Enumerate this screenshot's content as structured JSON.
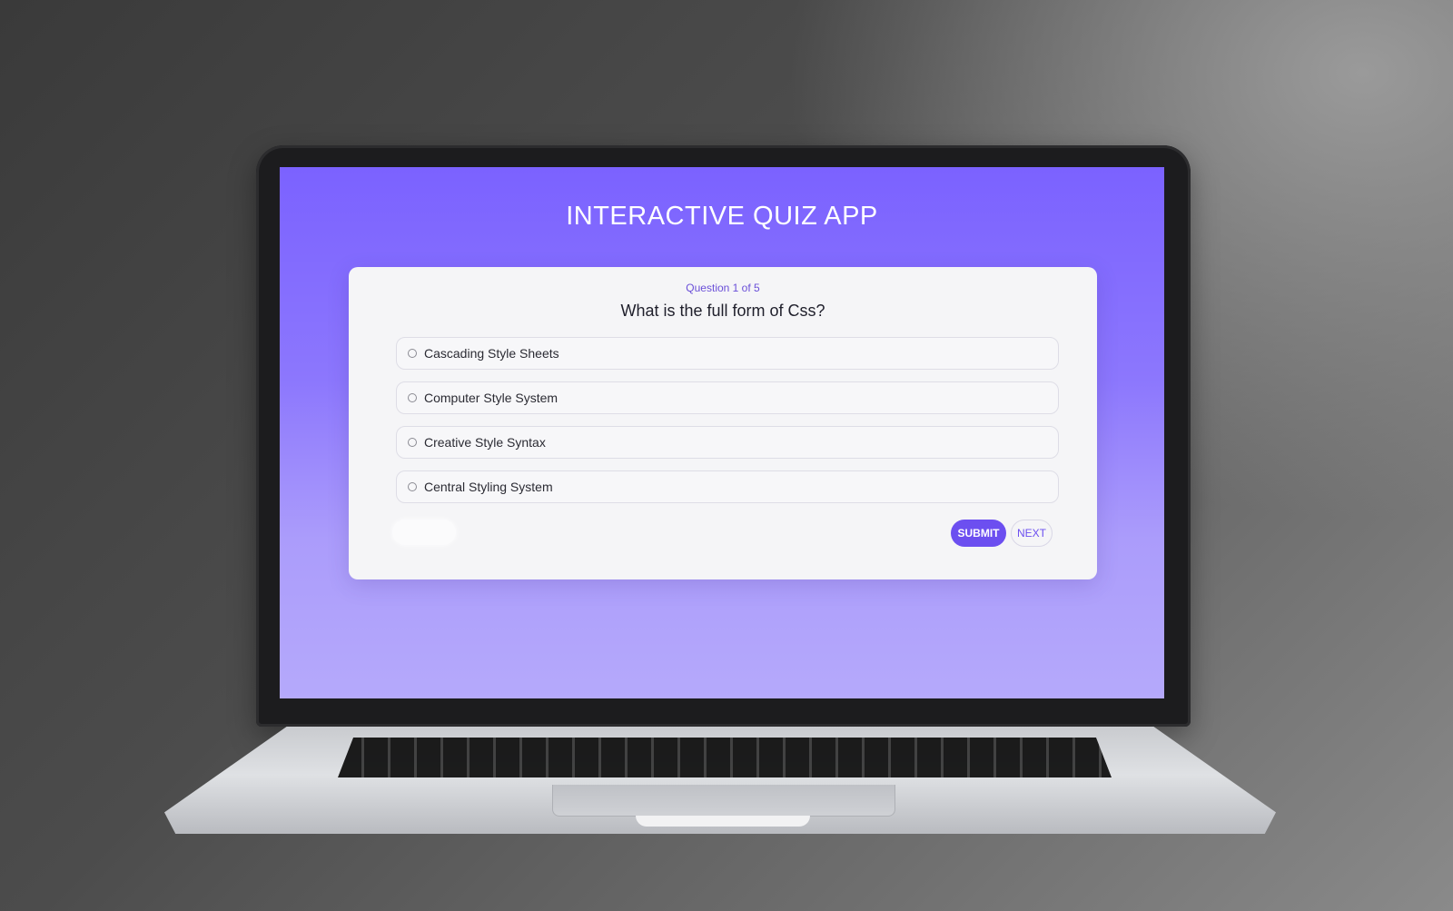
{
  "app": {
    "title": "INTERACTIVE QUIZ APP"
  },
  "quiz": {
    "counter": "Question 1 of 5",
    "question": "What is the full form of Css?",
    "options": [
      {
        "label": "Cascading Style Sheets"
      },
      {
        "label": "Computer Style System"
      },
      {
        "label": "Creative Style Syntax"
      },
      {
        "label": "Central Styling System"
      }
    ]
  },
  "controls": {
    "submit_label": "SUBMIT",
    "next_label": "NEXT"
  },
  "colors": {
    "screen_gradient_top": "#7b62ff",
    "screen_gradient_bottom": "#b5a9fb",
    "accent": "#6c4ff0",
    "card_background": "#f5f5f7"
  },
  "icons": {
    "option_marker": "radio-circle-icon"
  }
}
